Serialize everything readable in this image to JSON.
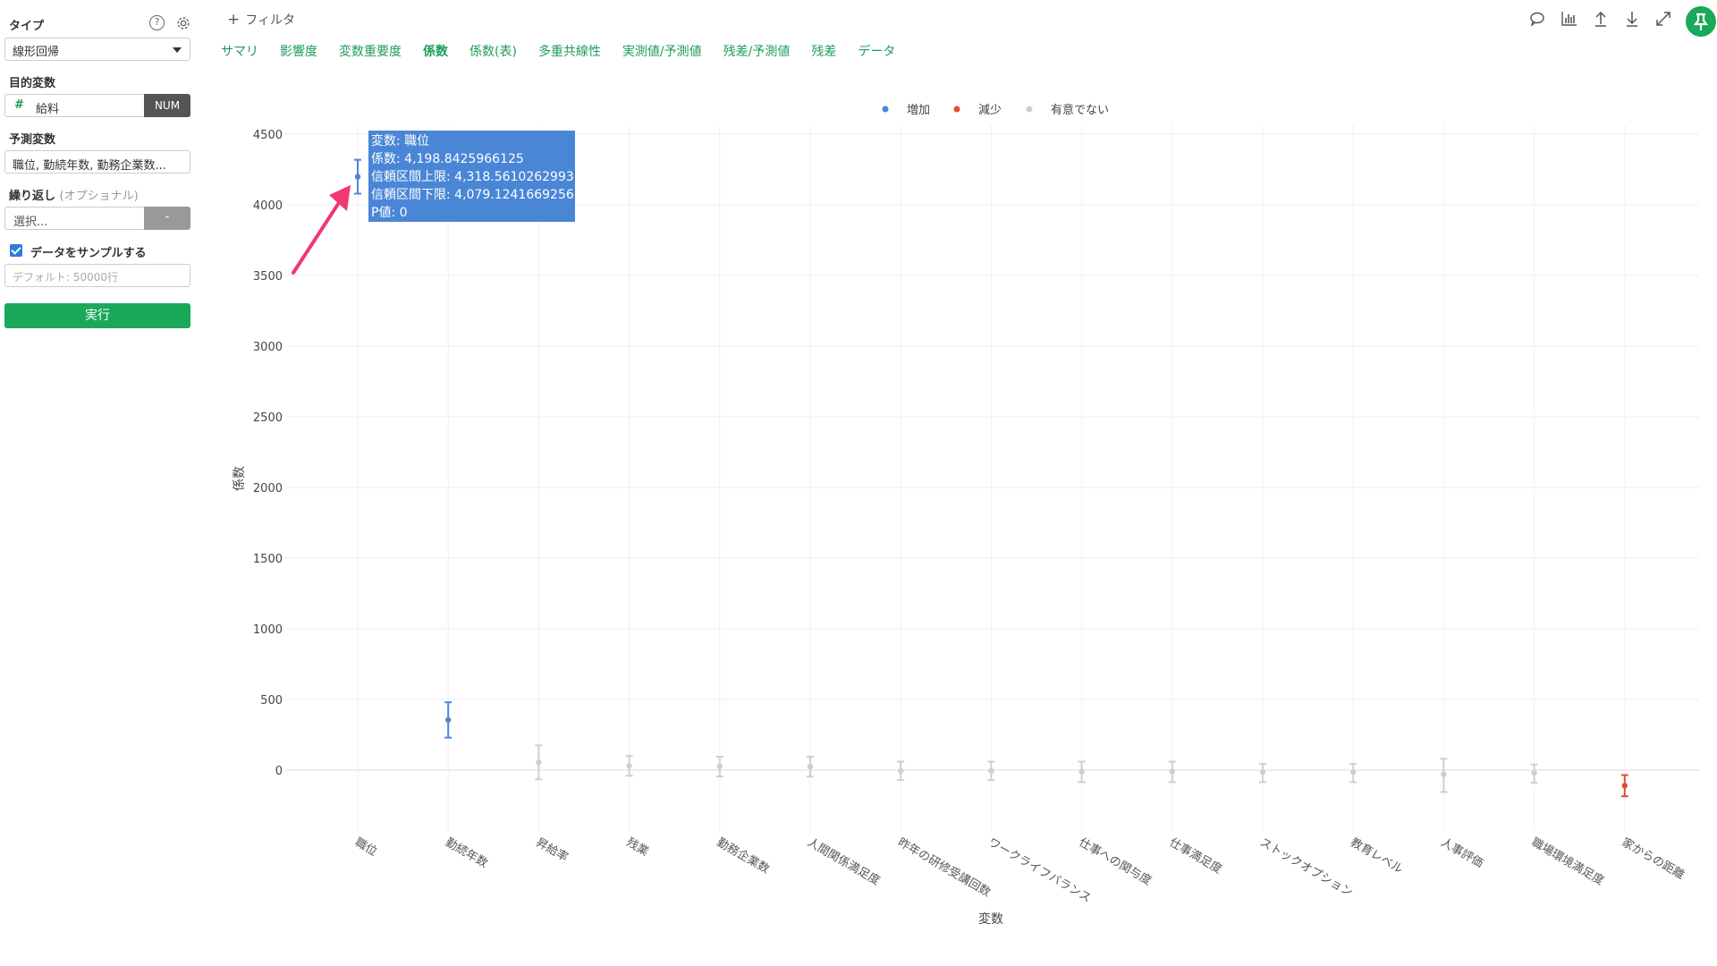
{
  "sidebar": {
    "type_label": "タイプ",
    "type_value": "線形回帰",
    "target_label": "目的変数",
    "target_value": "給料",
    "target_type": "NUM",
    "predictor_label": "予測変数",
    "predictor_value": "職位, 勤続年数, 勤務企業数...",
    "repeat_label": "繰り返し",
    "repeat_optional": "(オプショナル)",
    "repeat_placeholder": "選択...",
    "repeat_button": "-",
    "sample_label": "データをサンプルする",
    "sample_checked": true,
    "sample_placeholder": "デフォルト: 50000行",
    "run_label": "実行"
  },
  "header": {
    "filter_label": "フィルタ",
    "tabs": [
      "サマリ",
      "影響度",
      "変数重要度",
      "係数",
      "係数(表)",
      "多重共線性",
      "実測値/予測値",
      "残差/予測値",
      "残差",
      "データ"
    ],
    "active_tab": "係数"
  },
  "icons": [
    "comment-icon",
    "chart-icon",
    "upload-icon",
    "download-icon",
    "expand-icon",
    "pin-icon"
  ],
  "colors": {
    "accent": "#1aa85a",
    "increase": "#4a86d6",
    "decrease": "#e04b3a",
    "not_significant": "#cfcfcf"
  },
  "chart_data": {
    "type": "scatter",
    "xlabel": "変数",
    "ylabel": "係数",
    "ylim": [
      -200,
      4500
    ],
    "yticks": [
      0,
      500,
      1000,
      1500,
      2000,
      2500,
      3000,
      3500,
      4000,
      4500
    ],
    "legend": [
      {
        "name": "増加",
        "color": "#4a86d6"
      },
      {
        "name": "減少",
        "color": "#e04b3a"
      },
      {
        "name": "有意でない",
        "color": "#cfcfcf"
      }
    ],
    "legend_position": "top-center",
    "points": [
      {
        "x": "職位",
        "y": 4198.84,
        "lo": 4079.12,
        "hi": 4318.56,
        "group": "増加"
      },
      {
        "x": "勤続年数",
        "y": 355,
        "lo": 230,
        "hi": 480,
        "group": "増加"
      },
      {
        "x": "昇給率",
        "y": 55,
        "lo": -65,
        "hi": 175,
        "group": "有意でない"
      },
      {
        "x": "残業",
        "y": 30,
        "lo": -40,
        "hi": 100,
        "group": "有意でない"
      },
      {
        "x": "勤務企業数",
        "y": 25,
        "lo": -45,
        "hi": 95,
        "group": "有意でない"
      },
      {
        "x": "人間関係満足度",
        "y": 25,
        "lo": -45,
        "hi": 95,
        "group": "有意でない"
      },
      {
        "x": "昨年の研修受講回数",
        "y": -5,
        "lo": -70,
        "hi": 60,
        "group": "有意でない"
      },
      {
        "x": "ワークライフバランス",
        "y": -5,
        "lo": -70,
        "hi": 60,
        "group": "有意でない"
      },
      {
        "x": "仕事への関与度",
        "y": -10,
        "lo": -85,
        "hi": 60,
        "group": "有意でない"
      },
      {
        "x": "仕事満足度",
        "y": -10,
        "lo": -85,
        "hi": 60,
        "group": "有意でない"
      },
      {
        "x": "ストックオプション",
        "y": -15,
        "lo": -85,
        "hi": 45,
        "group": "有意でない"
      },
      {
        "x": "教育レベル",
        "y": -15,
        "lo": -85,
        "hi": 45,
        "group": "有意でない"
      },
      {
        "x": "人事評価",
        "y": -30,
        "lo": -155,
        "hi": 80,
        "group": "有意でない"
      },
      {
        "x": "職場環境満足度",
        "y": -20,
        "lo": -90,
        "hi": 40,
        "group": "有意でない"
      },
      {
        "x": "家からの距離",
        "y": -110,
        "lo": -185,
        "hi": -35,
        "group": "減少"
      }
    ],
    "tooltip": [
      "変数: 職位",
      "係数: 4,198.8425966125",
      "信頼区間上限: 4,318.5610262993",
      "信頼区間下限: 4,079.1241669256",
      "P値: 0"
    ]
  }
}
